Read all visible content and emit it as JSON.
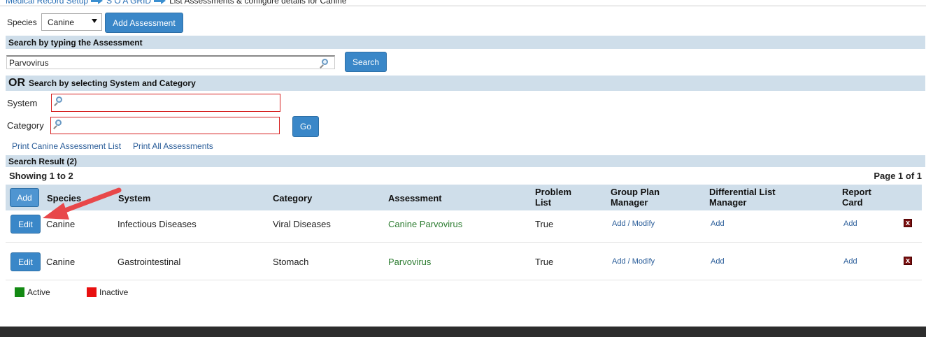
{
  "breadcrumb": {
    "items": [
      "Medical Record Setup",
      "S O A GRID",
      "List Assessments & configure details for Canine"
    ]
  },
  "species_filter": {
    "label": "Species",
    "selected": "Canine"
  },
  "add_assessment_label": "Add Assessment",
  "search_section": {
    "header": "Search by typing the Assessment",
    "value": "Parvovirus",
    "button": "Search"
  },
  "or_section": {
    "or_label": "OR",
    "header": "Search by selecting System and Category",
    "system_label": "System",
    "category_label": "Category",
    "go_button": "Go"
  },
  "links": {
    "print_species": "Print Canine Assessment List",
    "print_all": "Print All Assessments"
  },
  "results": {
    "header": "Search Result (2)",
    "showing": "Showing 1 to 2",
    "page": "Page 1 of 1",
    "add_button": "Add",
    "columns": {
      "species": "Species",
      "system": "System",
      "category": "Category",
      "assessment": "Assessment",
      "problem_list_1": "Problem",
      "problem_list_2": "List",
      "group_plan_1": "Group Plan",
      "group_plan_2": "Manager",
      "differential_1": "Differential List",
      "differential_2": "Manager",
      "report_card_1": "Report",
      "report_card_2": "Card"
    },
    "rows": [
      {
        "edit": "Edit",
        "species": "Canine",
        "system": "Infectious Diseases",
        "category": "Viral Diseases",
        "assessment": "Canine Parvovirus",
        "problem_list": "True",
        "group_plan": "Add / Modify",
        "differential": "Add",
        "report_card": "Add",
        "delete": "x"
      },
      {
        "edit": "Edit",
        "species": "Canine",
        "system": "Gastrointestinal",
        "category": "Stomach",
        "assessment": "Parvovirus",
        "problem_list": "True",
        "group_plan": "Add / Modify",
        "differential": "Add",
        "report_card": "Add",
        "delete": "x"
      }
    ]
  },
  "legend": {
    "active_label": "Active",
    "active_color": "#138a13",
    "inactive_label": "Inactive",
    "inactive_color": "#e81010"
  },
  "icons": {
    "search": "magnifier-icon",
    "arrow": "red-arrow-annotation",
    "delete": "delete-x-icon"
  }
}
